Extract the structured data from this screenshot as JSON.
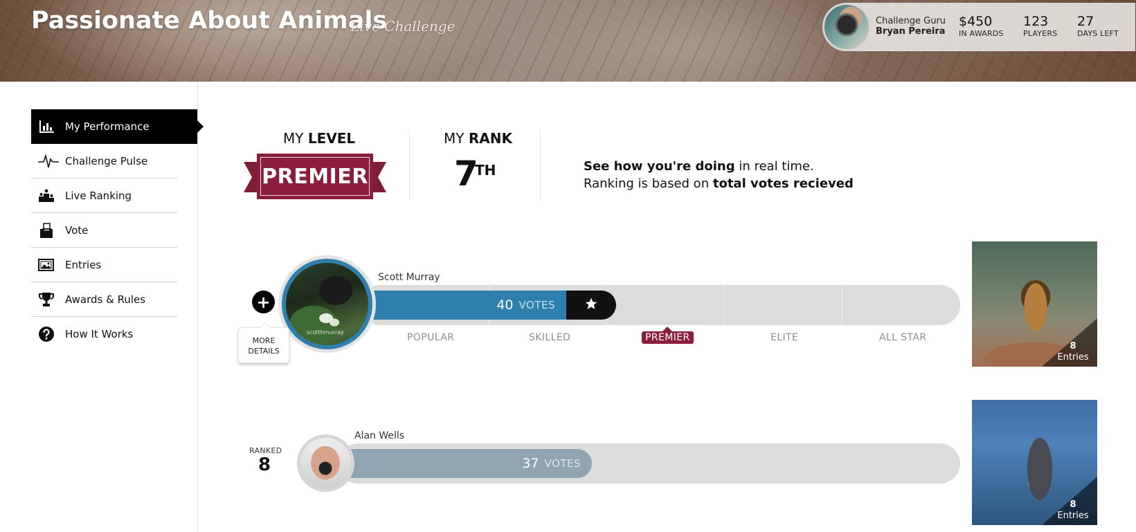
{
  "header": {
    "title": "Passionate About Animals",
    "subtitle": "Live Challenge",
    "guru": {
      "label": "Challenge Guru",
      "name": "Bryan Pereira"
    },
    "stats": [
      {
        "value": "$450",
        "label": "IN AWARDS"
      },
      {
        "value": "123",
        "label": "PLAYERS"
      },
      {
        "value": "27",
        "label": "DAYS LEFT"
      }
    ]
  },
  "sidebar": {
    "items": [
      {
        "label": "My Performance",
        "icon": "bar-chart-icon",
        "active": true
      },
      {
        "label": "Challenge Pulse",
        "icon": "pulse-icon"
      },
      {
        "label": "Live Ranking",
        "icon": "podium-icon"
      },
      {
        "label": "Vote",
        "icon": "ballot-box-icon"
      },
      {
        "label": "Entries",
        "icon": "image-icon"
      },
      {
        "label": "Awards & Rules",
        "icon": "trophy-icon"
      },
      {
        "label": "How It Works",
        "icon": "help-circle-icon"
      }
    ]
  },
  "level": {
    "head_prefix": "MY ",
    "head_strong": "LEVEL",
    "value": "PREMIER"
  },
  "rank": {
    "head_prefix": "MY ",
    "head_strong": "RANK",
    "value": "7",
    "suffix": "TH"
  },
  "info": {
    "line1_strong": "See how you're doing",
    "line1_rest": " in real time.",
    "line2_rest": "Ranking is based on ",
    "line2_strong": "total votes recieved"
  },
  "tiers": [
    "POPULAR",
    "SKILLED",
    "PREMIER",
    "ELITE",
    "ALL STAR"
  ],
  "current_tier": "PREMIER",
  "my_row": {
    "name": "Scott Murray",
    "votes": "40",
    "votes_label": "VOTES",
    "watermark": "scotthmurray",
    "more_line1": "MORE",
    "more_line2": "DETAILS",
    "entries_count": "8",
    "entries_label": "Entries",
    "star_icon": "star-icon"
  },
  "next_row": {
    "ranked_label": "RANKED",
    "rank": "8",
    "name": "Alan Wells",
    "votes": "37",
    "votes_label": "VOTES",
    "entries_count": "8",
    "entries_label": "Entries"
  },
  "colors": {
    "accent": "#8b1e3c",
    "my_bar": "#2f7fad",
    "other_bar": "#8fa5b3",
    "track": "#dcdcdc"
  }
}
